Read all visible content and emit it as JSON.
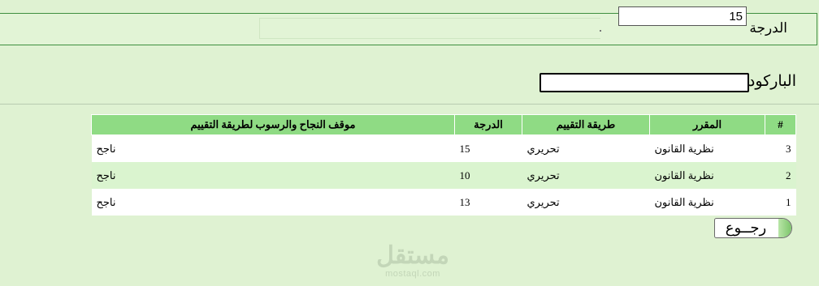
{
  "grade_field": {
    "label": "الدرجة",
    "value": "15"
  },
  "barcode_field": {
    "label": "الباركود",
    "value": ""
  },
  "table": {
    "headers": {
      "index": "#",
      "course": "المقرر",
      "method": "طريقة التقييم",
      "grade": "الدرجة",
      "status": "موقف النجاح والرسوب لطريقة التقييم"
    },
    "rows": [
      {
        "index": "3",
        "course": "نظرية القانون",
        "method": "تحريري",
        "grade": "15",
        "status": "ناجح"
      },
      {
        "index": "2",
        "course": "نظرية القانون",
        "method": "تحريري",
        "grade": "10",
        "status": "ناجح"
      },
      {
        "index": "1",
        "course": "نظرية القانون",
        "method": "تحريري",
        "grade": "13",
        "status": "ناجح"
      }
    ]
  },
  "back_button": {
    "label": "رجــوع"
  },
  "watermark": {
    "logo": "مستقل",
    "url": "mostaql.com"
  },
  "colors": {
    "header_bg": "#8fdb84",
    "page_bg": "#dff2d2",
    "panel_border": "#3f8f3f"
  }
}
